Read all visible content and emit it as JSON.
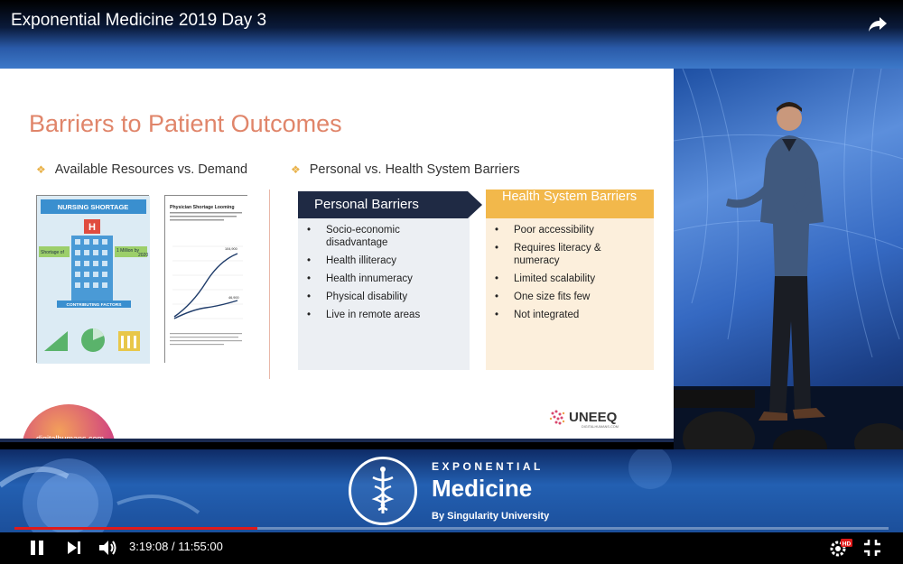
{
  "video": {
    "title": "Exponential Medicine 2019 Day 3",
    "time_current": "3:19:08",
    "time_separator": " / ",
    "time_total": "11:55:00",
    "progress": 0.278,
    "hd_badge": "HD"
  },
  "slide": {
    "title": "Barriers to Patient Outcomes",
    "left_heading": "Available Resources vs. Demand",
    "right_heading": "Personal vs. Health System Barriers",
    "nursing": {
      "title": "NURSING SHORTAGE",
      "line1": "Shortage of",
      "line2": "1 Million by",
      "line3": "2020",
      "contrib": "CONTRIBUTING FACTORS"
    },
    "physician": {
      "title": "Physician Shortage Looming",
      "value_high": "104,900",
      "value_low": "46,900"
    },
    "personal_title": "Personal Barriers",
    "health_title": "Health System Barriers",
    "personal_items": [
      "Socio-economic disadvantage",
      "Health illiteracy",
      "Health innumeracy",
      "Physical disability",
      "Live in remote areas"
    ],
    "health_items": [
      "Poor accessibility",
      "Requires literacy & numeracy",
      "Limited scalability",
      "One size fits few",
      "Not integrated"
    ],
    "badge_text": "digitalhumans.com",
    "logo_text": "UNEEQ",
    "logo_sub": "DIGITALHUMANS.COM"
  },
  "banner": {
    "top": "EXPONENTIAL",
    "mid": "Medicine",
    "bot": "By Singularity University"
  },
  "colors": {
    "accent_title": "#e0856a",
    "personal_bar": "#1f2a44",
    "health_bar": "#f2b84b",
    "progress": "#e01a1a"
  }
}
